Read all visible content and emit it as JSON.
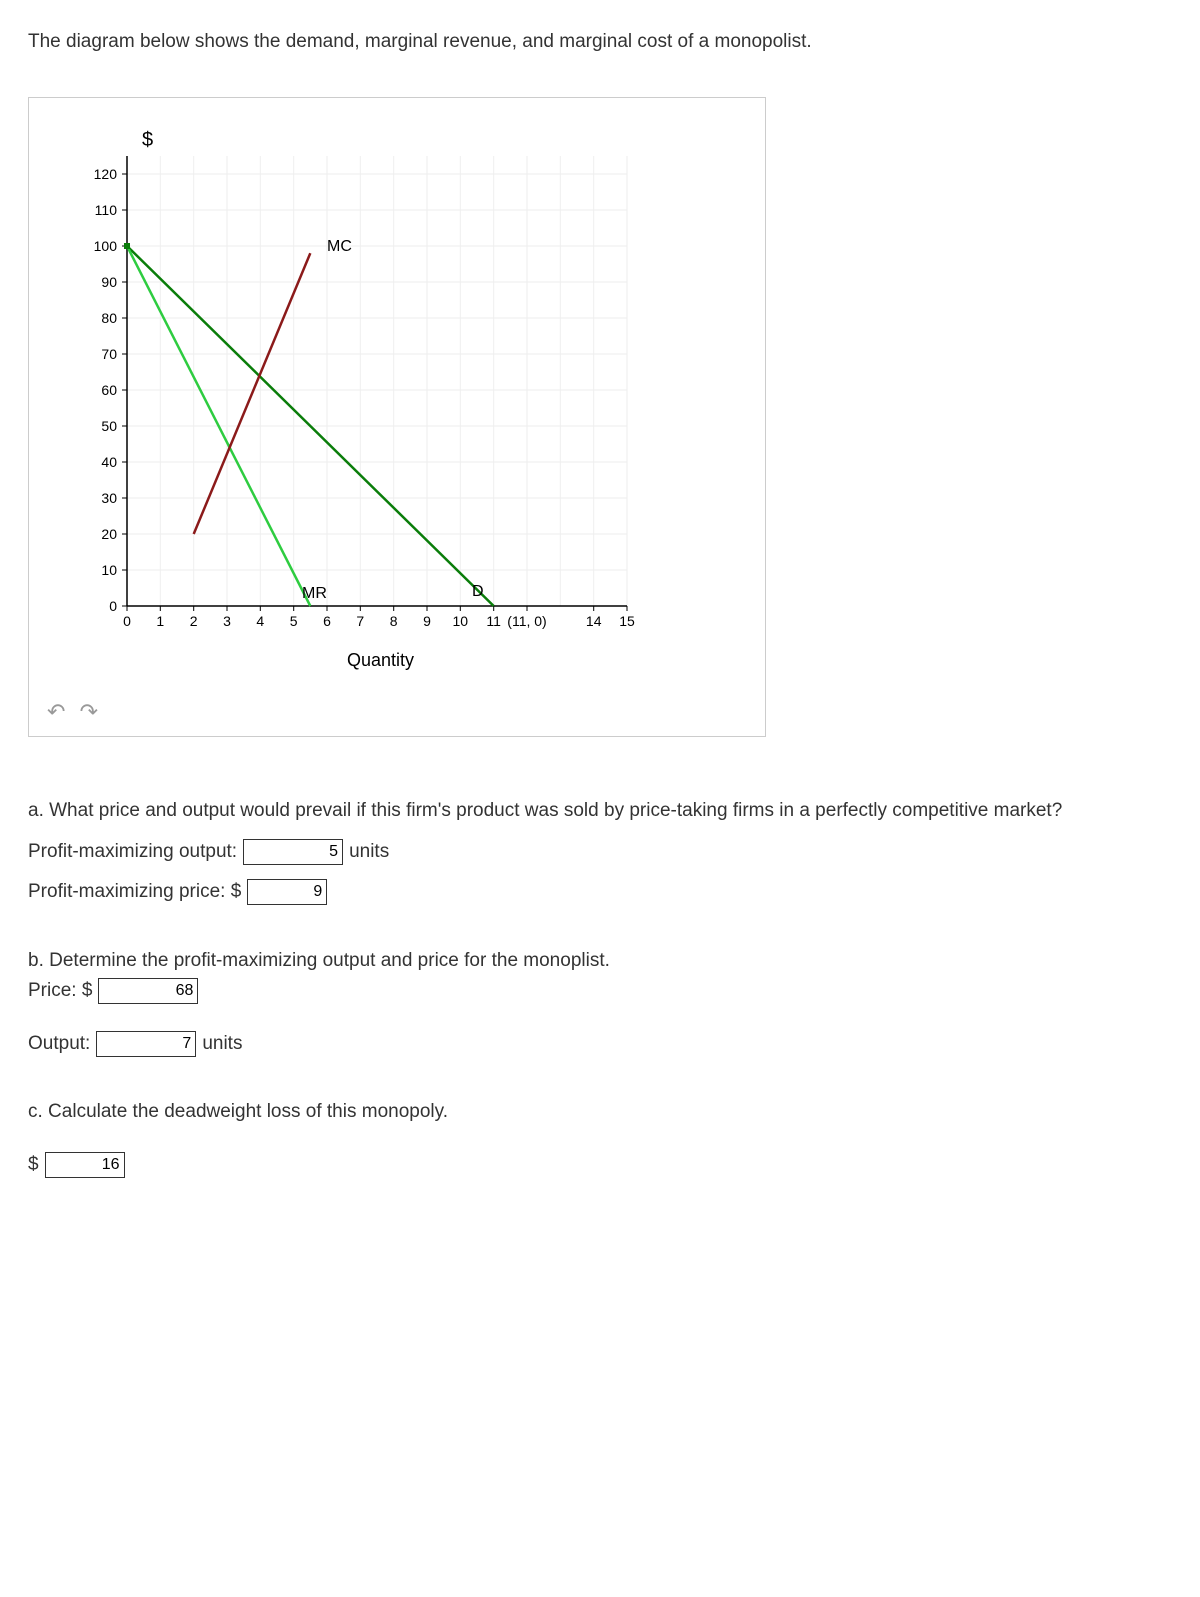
{
  "intro": "The diagram below shows the demand, marginal revenue, and marginal cost of a monopolist.",
  "chart_data": {
    "type": "line",
    "ylabel": "$",
    "xlabel": "Quantity",
    "yticks": [
      0,
      10,
      20,
      30,
      40,
      50,
      60,
      70,
      80,
      90,
      100,
      110,
      120
    ],
    "xticks": [
      0,
      1,
      2,
      3,
      4,
      5,
      6,
      7,
      8,
      9,
      10,
      11,
      12,
      13,
      14,
      15
    ],
    "xtick_labels": [
      "0",
      "1",
      "2",
      "3",
      "4",
      "5",
      "6",
      "7",
      "8",
      "9",
      "10",
      "11",
      "(11, 0)",
      "",
      "14",
      "15"
    ],
    "series": [
      {
        "name": "D",
        "color": "#0a7d0a",
        "points": [
          [
            0,
            100
          ],
          [
            11,
            0
          ]
        ]
      },
      {
        "name": "MR",
        "color": "#2ecc40",
        "points": [
          [
            0,
            100
          ],
          [
            5.5,
            0
          ]
        ]
      },
      {
        "name": "MC",
        "color": "#8b1a1a",
        "points": [
          [
            2,
            20
          ],
          [
            5.5,
            98
          ]
        ]
      }
    ],
    "line_labels": {
      "MC": "MC",
      "MR": "MR",
      "D": "D"
    },
    "ylim": [
      0,
      125
    ],
    "xlim": [
      0,
      15
    ]
  },
  "qa": {
    "a_prompt": "a.  What price and output would prevail if this firm's product was sold by price-taking firms in a perfectly competitive market?",
    "output_label": "Profit-maximizing output:",
    "output_value": "5",
    "output_unit": "units",
    "price_label": "Profit-maximizing price: $",
    "price_value": "9"
  },
  "qb": {
    "b_prompt": "b. Determine the profit-maximizing output and price for the monoplist.",
    "price_label": "Price: $",
    "price_value": "68",
    "output_label": "Output:",
    "output_value": "7",
    "output_unit": "units"
  },
  "qc": {
    "c_prompt": "c. Calculate the deadweight loss of this monopoly.",
    "currency": "$",
    "value": "16"
  }
}
